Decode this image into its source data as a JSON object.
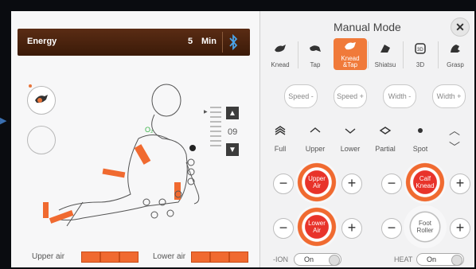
{
  "energy": {
    "label": "Energy",
    "value": "5",
    "unit": "Min"
  },
  "right_panel": {
    "title": "Manual Mode",
    "close_label": "✕",
    "modes": [
      {
        "label": "Knead",
        "icon": "knead-icon"
      },
      {
        "label": "Tap",
        "icon": "tap-icon"
      },
      {
        "label": "Knead\n&Tap",
        "icon": "knead-tap-icon",
        "active": true
      },
      {
        "label": "Shiatsu",
        "icon": "shiatsu-icon"
      },
      {
        "label": "3D",
        "icon": "3d-icon"
      },
      {
        "label": "Grasp",
        "icon": "grasp-icon"
      }
    ],
    "pills": [
      "Speed -",
      "Speed +",
      "Width -",
      "Width +"
    ],
    "areas": [
      "Full",
      "Upper",
      "Lower",
      "Partial",
      "Spot"
    ],
    "controls": {
      "upper_air": {
        "label": "Upper\nAir",
        "minus": "−",
        "plus": "+"
      },
      "calf_knead": {
        "label": "Calf\nKnead",
        "minus": "−",
        "plus": "+"
      },
      "lower_air": {
        "label": "Lower\nAir",
        "minus": "−",
        "plus": "+"
      },
      "foot_roller": {
        "label": "Foot\nRoller",
        "minus": "−",
        "plus": "+"
      }
    },
    "toggles": {
      "ion": {
        "label": "-ION",
        "value": "On"
      },
      "heat": {
        "label": "HEAT",
        "value": "On"
      }
    }
  },
  "level": {
    "value": "09"
  },
  "air": {
    "upper_label": "Upper air",
    "lower_label": "Lower air"
  },
  "colors": {
    "accent": "#f07a3a",
    "active_red": "#e8332a",
    "bar_brown": "#4a220e"
  }
}
